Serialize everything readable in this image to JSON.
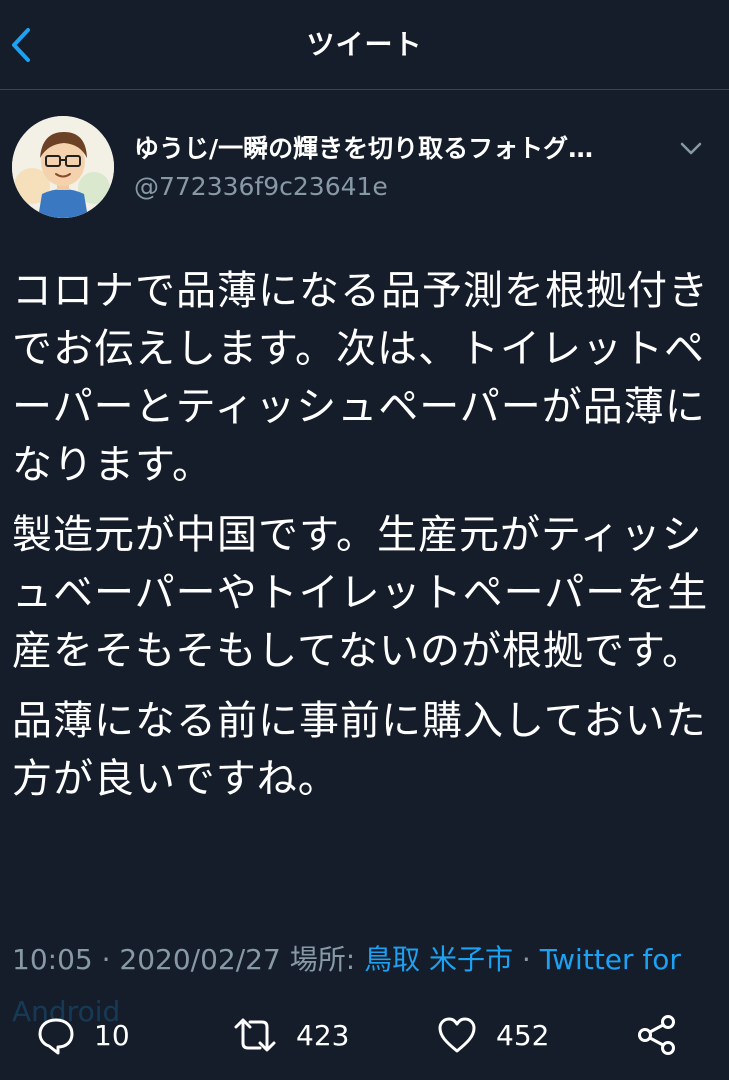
{
  "header": {
    "title": "ツイート"
  },
  "author": {
    "display_name": "ゆうじ/一瞬の輝きを切り取るフォトグ…",
    "handle": "@772336f9c23641e"
  },
  "tweet": {
    "paragraphs": [
      "コロナで品薄になる品予測を根拠付きでお伝えします。次は、トイレットペーパーとティッシュペーパーが品薄になります。",
      "製造元が中国です。生産元がティッシュベーパーやトイレットペーパーを生産をそもそもしてないのが根拠です。",
      "品薄になる前に事前に購入しておいた方が良いですね。"
    ],
    "time": "10:05",
    "separator": "·",
    "date": "2020/02/27",
    "location_label": "場所:",
    "location": "鳥取 米子市",
    "client_line1": "Twitter for",
    "client_line2": "Android"
  },
  "actions": {
    "reply_count": "10",
    "retweet_count": "423",
    "like_count": "452"
  },
  "colors": {
    "background": "#151d2a",
    "accent": "#1da1f2",
    "secondary_text": "#8899a6"
  },
  "icons": [
    "back-chevron-icon",
    "chevron-down-icon",
    "reply-icon",
    "retweet-icon",
    "like-icon",
    "share-icon"
  ]
}
